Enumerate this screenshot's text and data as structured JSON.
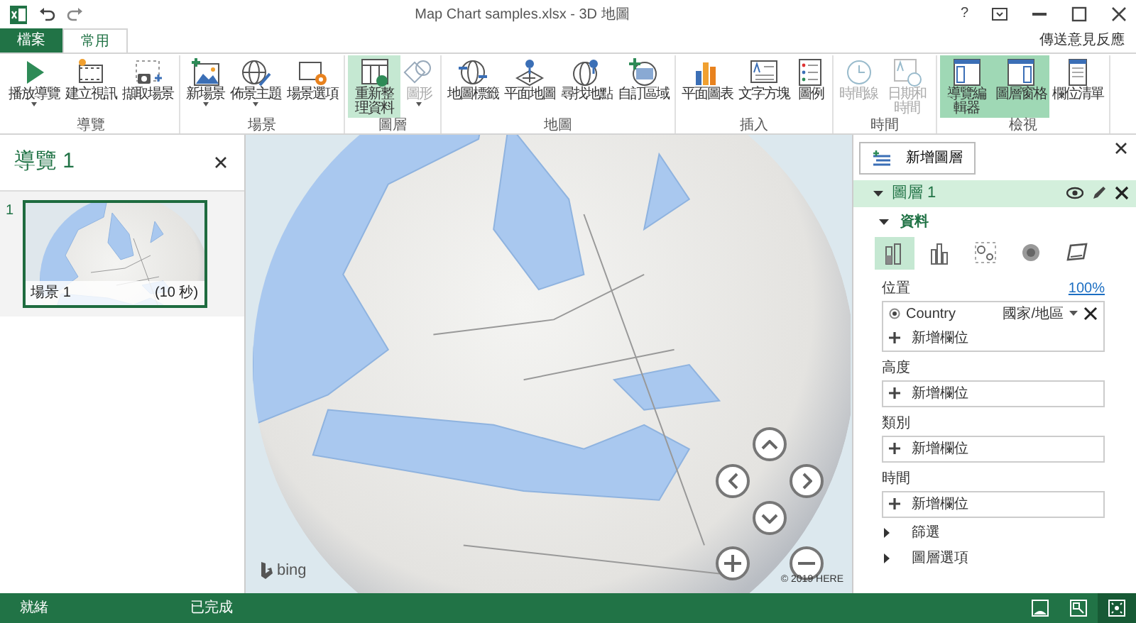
{
  "window": {
    "title": "Map Chart samples.xlsx - 3D 地圖",
    "help": "?",
    "feedback": "傳送意見反應"
  },
  "tabs": [
    {
      "label": "檔案",
      "kind": "file",
      "selected": false
    },
    {
      "label": "常用",
      "kind": "tab",
      "selected": true
    }
  ],
  "ribbon_groups": [
    {
      "label": "導覽",
      "buttons": [
        {
          "label": "播放導覽",
          "dropdown": true,
          "selected": false,
          "disabled": false
        },
        {
          "label": "建立視訊",
          "dropdown": false,
          "selected": false,
          "disabled": false
        },
        {
          "label": "擷取場景",
          "dropdown": false,
          "selected": false,
          "disabled": false
        }
      ]
    },
    {
      "label": "場景",
      "buttons": [
        {
          "label": "新場景",
          "dropdown": true,
          "selected": false,
          "disabled": false
        },
        {
          "label": "佈景主題",
          "dropdown": true,
          "selected": false,
          "disabled": false
        },
        {
          "label": "場景選項",
          "dropdown": false,
          "selected": false,
          "disabled": false
        }
      ]
    },
    {
      "label": "圖層",
      "buttons": [
        {
          "label": "重新整理資料",
          "dropdown": false,
          "selected": true,
          "disabled": false
        },
        {
          "label": "圖形",
          "dropdown": true,
          "selected": false,
          "disabled": true
        }
      ]
    },
    {
      "label": "地圖",
      "buttons": [
        {
          "label": "地圖標籤",
          "dropdown": false,
          "selected": false,
          "disabled": false
        },
        {
          "label": "平面地圖",
          "dropdown": false,
          "selected": false,
          "disabled": false
        },
        {
          "label": "尋找地點",
          "dropdown": false,
          "selected": false,
          "disabled": false
        },
        {
          "label": "自訂區域",
          "dropdown": false,
          "selected": false,
          "disabled": false
        }
      ]
    },
    {
      "label": "插入",
      "buttons": [
        {
          "label": "平面圖表",
          "dropdown": false,
          "selected": false,
          "disabled": false
        },
        {
          "label": "文字方塊",
          "dropdown": false,
          "selected": false,
          "disabled": false
        },
        {
          "label": "圖例",
          "dropdown": false,
          "selected": false,
          "disabled": false
        }
      ]
    },
    {
      "label": "時間",
      "buttons": [
        {
          "label": "時間線",
          "dropdown": false,
          "selected": false,
          "disabled": true
        },
        {
          "label": "日期和時間",
          "dropdown": false,
          "selected": false,
          "disabled": true
        }
      ]
    },
    {
      "label": "檢視",
      "buttons": [
        {
          "label": "導覽編輯器",
          "dropdown": false,
          "selected": true,
          "disabled": false
        },
        {
          "label": "圖層窗格",
          "dropdown": false,
          "selected": true,
          "disabled": false
        },
        {
          "label": "欄位清單",
          "dropdown": false,
          "selected": false,
          "disabled": false
        }
      ]
    }
  ],
  "tour_pane": {
    "title": "導覽 1",
    "scenes": [
      {
        "number": "1",
        "name": "場景 1",
        "duration": "(10 秒)",
        "selected": true
      }
    ]
  },
  "map": {
    "logo_text": "bing",
    "attribution": "© 2019 HERE"
  },
  "layer_pane": {
    "add_layer": "新增圖層",
    "layer": {
      "name": "圖層 1",
      "expanded": true
    },
    "section": {
      "title": "資料",
      "expanded": true
    },
    "chart_types": [
      {
        "selected": true
      },
      {
        "selected": false
      },
      {
        "selected": false
      },
      {
        "selected": false
      },
      {
        "selected": false
      }
    ],
    "fields": [
      {
        "label": "位置",
        "link": "100%",
        "entries": [
          {
            "name": "Country",
            "type": "國家/地區"
          }
        ],
        "add": "新增欄位"
      },
      {
        "label": "高度",
        "add": "新增欄位"
      },
      {
        "label": "類別",
        "add": "新增欄位"
      },
      {
        "label": "時間",
        "add": "新增欄位"
      }
    ],
    "sections": [
      {
        "title": "篩選",
        "expanded": false
      },
      {
        "title": "圖層選項",
        "expanded": false
      }
    ]
  },
  "status_bar": {
    "status": "就緒",
    "progress": "已完成",
    "views": [
      {
        "selected": false
      },
      {
        "selected": false
      },
      {
        "selected": true
      }
    ]
  }
}
